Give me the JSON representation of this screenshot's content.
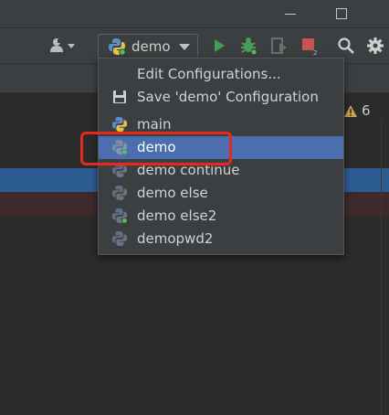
{
  "window": {
    "minimize_glyph": "",
    "maximize_glyph": ""
  },
  "toolbar": {
    "user_icon": "user-icon",
    "run_config": {
      "label": "demo",
      "icon": "python-icon"
    },
    "run_icon": "run-icon",
    "debug_icon": "debug-icon",
    "coverage_icon": "coverage-icon",
    "stop_icon": "stop-icon",
    "search_icon": "search-icon",
    "settings_icon": "gear-icon"
  },
  "editor": {
    "warnings": {
      "count": "6",
      "icon": "warning-icon"
    }
  },
  "config_menu": {
    "actions": [
      {
        "label": "Edit Configurations...",
        "icon": ""
      },
      {
        "label": "Save 'demo' Configuration",
        "icon": "save-icon"
      }
    ],
    "configurations": [
      {
        "label": "main",
        "running": false,
        "selected": false
      },
      {
        "label": "demo",
        "running": true,
        "selected": true
      },
      {
        "label": "demo continue",
        "running": false,
        "selected": false
      },
      {
        "label": "demo else",
        "running": false,
        "selected": false
      },
      {
        "label": "demo else2",
        "running": true,
        "selected": false
      },
      {
        "label": "demopwd2",
        "running": false,
        "selected": false
      }
    ]
  },
  "colors": {
    "toolbar_bg": "#3c3f41",
    "editor_bg": "#2b2b2b",
    "selection": "#4b6eaf",
    "annotation_red": "#e8281c",
    "run_green": "#499c54",
    "stop_red": "#c75450"
  }
}
